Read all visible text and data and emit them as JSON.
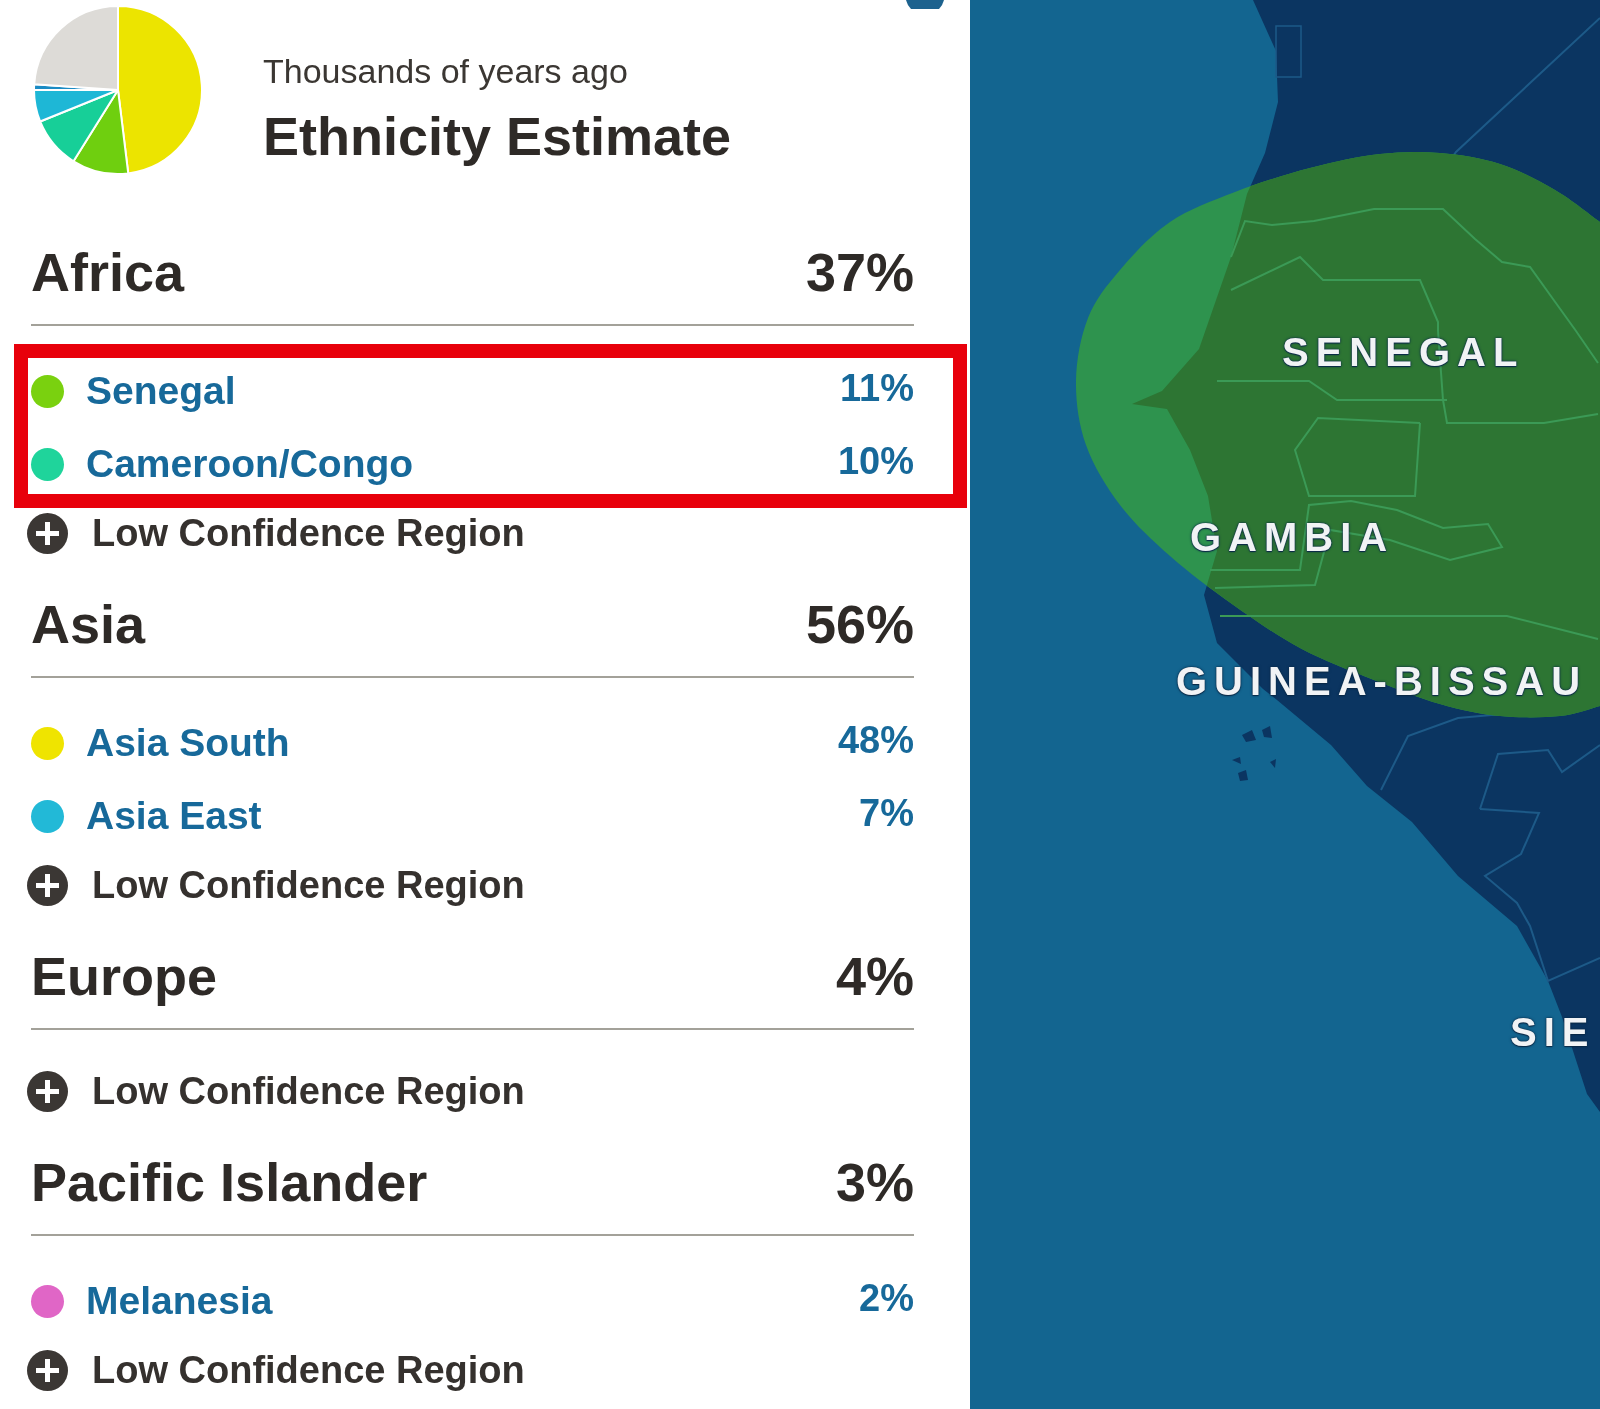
{
  "header": {
    "subtitle": "Thousands of years ago",
    "title": "Ethnicity Estimate"
  },
  "groups": [
    {
      "name": "Africa",
      "percent": "37%",
      "regions": [
        {
          "name": "Senegal",
          "percent": "11%",
          "color": "#7ad10f",
          "highlighted": true
        },
        {
          "name": "Cameroon/Congo",
          "percent": "10%",
          "color": "#1fd49b",
          "highlighted": true
        }
      ],
      "low_confidence": {
        "label": "Low Confidence Region",
        "expanded": false
      }
    },
    {
      "name": "Asia",
      "percent": "56%",
      "regions": [
        {
          "name": "Asia South",
          "percent": "48%",
          "color": "#efe400",
          "highlighted": false
        },
        {
          "name": "Asia East",
          "percent": "7%",
          "color": "#22b9d7",
          "highlighted": false
        }
      ],
      "low_confidence": {
        "label": "Low Confidence Region",
        "expanded": false
      }
    },
    {
      "name": "Europe",
      "percent": "4%",
      "low_confidence": {
        "label": "Low Confidence Region",
        "expanded": false
      }
    },
    {
      "name": "Pacific Islander",
      "percent": "3%",
      "regions": [
        {
          "name": "Melanesia",
          "percent": "2%",
          "color": "#e066c6",
          "highlighted": false
        }
      ],
      "low_confidence": {
        "label": "Low Confidence Region",
        "expanded": false
      }
    }
  ],
  "map": {
    "labels": [
      {
        "text": "SENEGAL"
      },
      {
        "text": "GAMBIA"
      },
      {
        "text": "GUINEA-BISSAU"
      },
      {
        "text": "SIE"
      }
    ]
  }
}
